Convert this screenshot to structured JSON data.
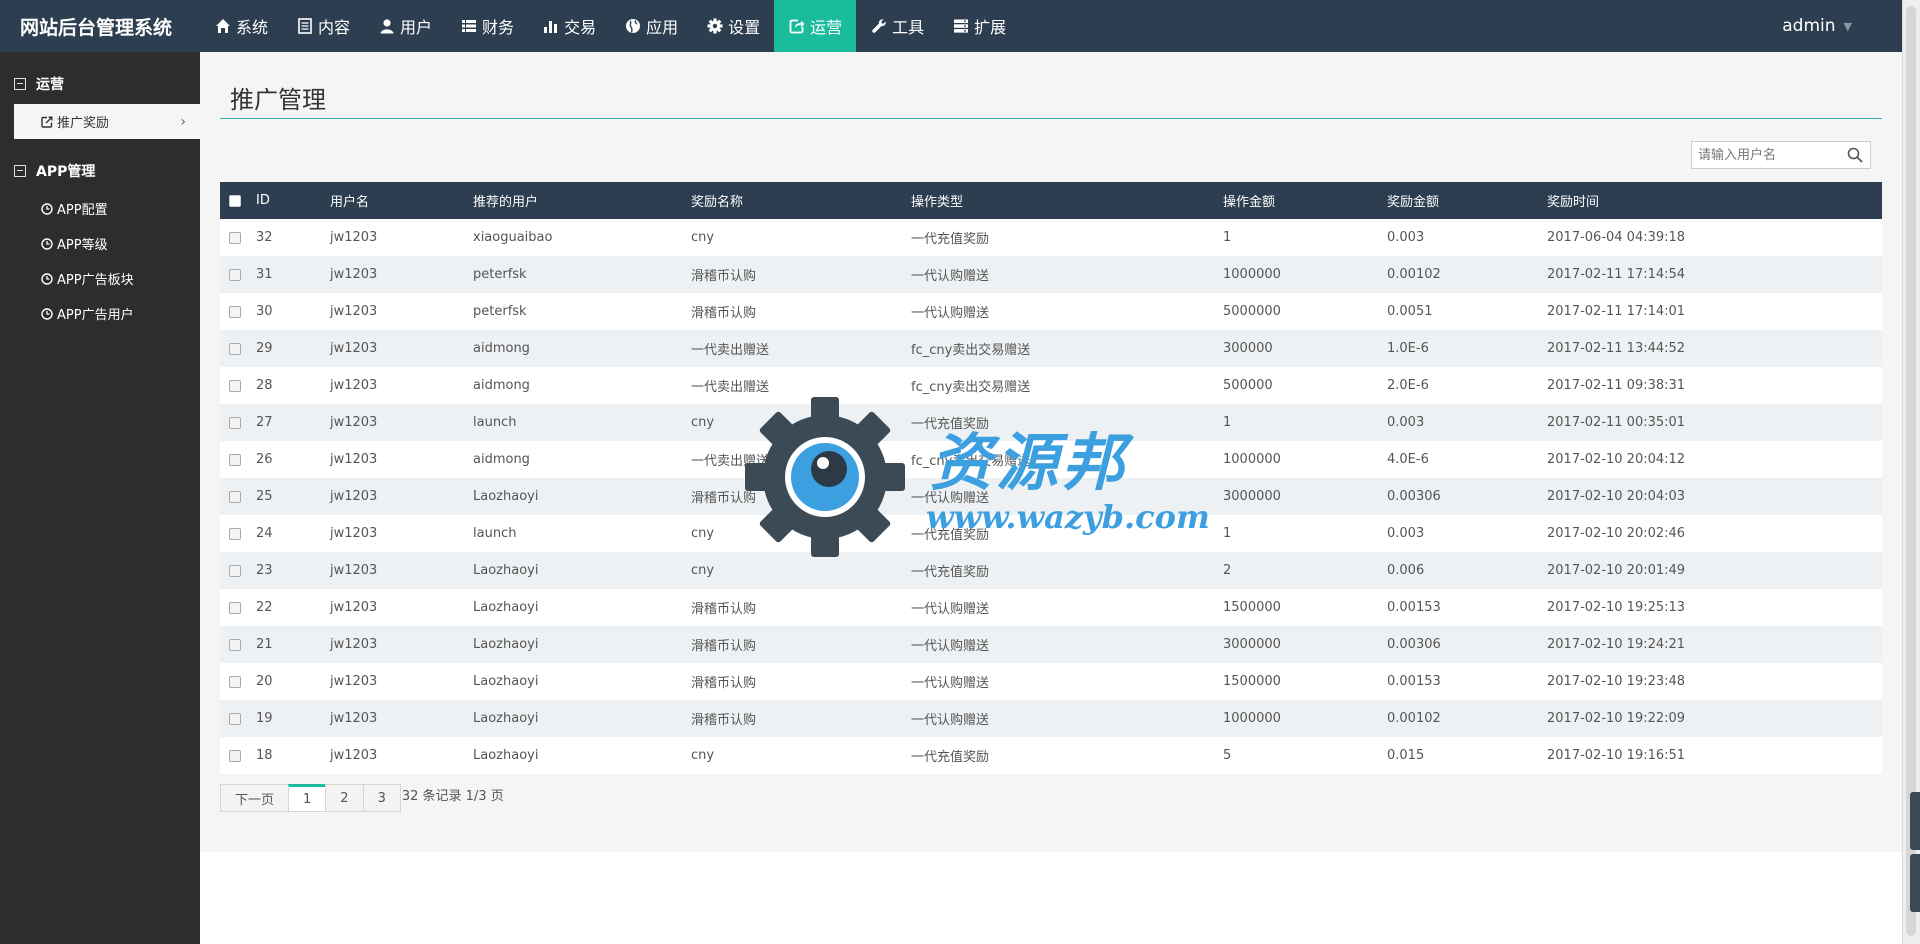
{
  "app": {
    "title": "网站后台管理系统"
  },
  "topnav": [
    {
      "label": "系统",
      "icon": "home-icon",
      "active": false
    },
    {
      "label": "内容",
      "icon": "document-icon",
      "active": false
    },
    {
      "label": "用户",
      "icon": "user-icon",
      "active": false
    },
    {
      "label": "财务",
      "icon": "list-icon",
      "active": false
    },
    {
      "label": "交易",
      "icon": "bar-chart-icon",
      "active": false
    },
    {
      "label": "应用",
      "icon": "globe-icon",
      "active": false
    },
    {
      "label": "设置",
      "icon": "gear-icon",
      "active": false
    },
    {
      "label": "运营",
      "icon": "share-icon",
      "active": true
    },
    {
      "label": "工具",
      "icon": "wrench-icon",
      "active": false
    },
    {
      "label": "扩展",
      "icon": "server-icon",
      "active": false
    }
  ],
  "user": {
    "name": "admin"
  },
  "sidebar": {
    "groups": [
      {
        "label": "运营",
        "items": [
          {
            "label": "推广奖励",
            "icon": "external-link-icon",
            "active": true
          }
        ]
      },
      {
        "label": "APP管理",
        "items": [
          {
            "label": "APP配置",
            "icon": "clock-icon",
            "active": false
          },
          {
            "label": "APP等级",
            "icon": "clock-icon",
            "active": false
          },
          {
            "label": "APP广告板块",
            "icon": "clock-icon",
            "active": false
          },
          {
            "label": "APP广告用户",
            "icon": "clock-icon",
            "active": false
          }
        ]
      }
    ]
  },
  "page": {
    "title": "推广管理"
  },
  "search": {
    "placeholder": "请输入用户名"
  },
  "table": {
    "columns": [
      "ID",
      "用户名",
      "推荐的用户",
      "奖励名称",
      "操作类型",
      "操作金额",
      "奖励金额",
      "奖励时间"
    ],
    "rows": [
      [
        "32",
        "jw1203",
        "xiaoguaibao",
        "cny",
        "一代充值奖励",
        "1",
        "0.003",
        "2017-06-04 04:39:18"
      ],
      [
        "31",
        "jw1203",
        "peterfsk",
        "滑稽币认购",
        "一代认购赠送",
        "1000000",
        "0.00102",
        "2017-02-11 17:14:54"
      ],
      [
        "30",
        "jw1203",
        "peterfsk",
        "滑稽币认购",
        "一代认购赠送",
        "5000000",
        "0.0051",
        "2017-02-11 17:14:01"
      ],
      [
        "29",
        "jw1203",
        "aidmong",
        "一代卖出赠送",
        "fc_cny卖出交易赠送",
        "300000",
        "1.0E-6",
        "2017-02-11 13:44:52"
      ],
      [
        "28",
        "jw1203",
        "aidmong",
        "一代卖出赠送",
        "fc_cny卖出交易赠送",
        "500000",
        "2.0E-6",
        "2017-02-11 09:38:31"
      ],
      [
        "27",
        "jw1203",
        "launch",
        "cny",
        "一代充值奖励",
        "1",
        "0.003",
        "2017-02-11 00:35:01"
      ],
      [
        "26",
        "jw1203",
        "aidmong",
        "一代卖出赠送",
        "fc_cny卖出交易赠送",
        "1000000",
        "4.0E-6",
        "2017-02-10 20:04:12"
      ],
      [
        "25",
        "jw1203",
        "Laozhaoyi",
        "滑稽币认购",
        "一代认购赠送",
        "3000000",
        "0.00306",
        "2017-02-10 20:04:03"
      ],
      [
        "24",
        "jw1203",
        "launch",
        "cny",
        "一代充值奖励",
        "1",
        "0.003",
        "2017-02-10 20:02:46"
      ],
      [
        "23",
        "jw1203",
        "Laozhaoyi",
        "cny",
        "一代充值奖励",
        "2",
        "0.006",
        "2017-02-10 20:01:49"
      ],
      [
        "22",
        "jw1203",
        "Laozhaoyi",
        "滑稽币认购",
        "一代认购赠送",
        "1500000",
        "0.00153",
        "2017-02-10 19:25:13"
      ],
      [
        "21",
        "jw1203",
        "Laozhaoyi",
        "滑稽币认购",
        "一代认购赠送",
        "3000000",
        "0.00306",
        "2017-02-10 19:24:21"
      ],
      [
        "20",
        "jw1203",
        "Laozhaoyi",
        "滑稽币认购",
        "一代认购赠送",
        "1500000",
        "0.00153",
        "2017-02-10 19:23:48"
      ],
      [
        "19",
        "jw1203",
        "Laozhaoyi",
        "滑稽币认购",
        "一代认购赠送",
        "1000000",
        "0.00102",
        "2017-02-10 19:22:09"
      ],
      [
        "18",
        "jw1203",
        "Laozhaoyi",
        "cny",
        "一代充值奖励",
        "5",
        "0.015",
        "2017-02-10 19:16:51"
      ]
    ]
  },
  "pagination": {
    "next_label": "下一页",
    "pages": [
      "1",
      "2",
      "3"
    ],
    "current": "1",
    "summary": "32 条记录 1/3 页"
  },
  "watermark": {
    "text": "资源邦",
    "url": "www.wazyb.com"
  },
  "colors": {
    "topbar": "#2d3e50",
    "accent": "#1abc9c",
    "sidebar": "#2d2d2d"
  }
}
